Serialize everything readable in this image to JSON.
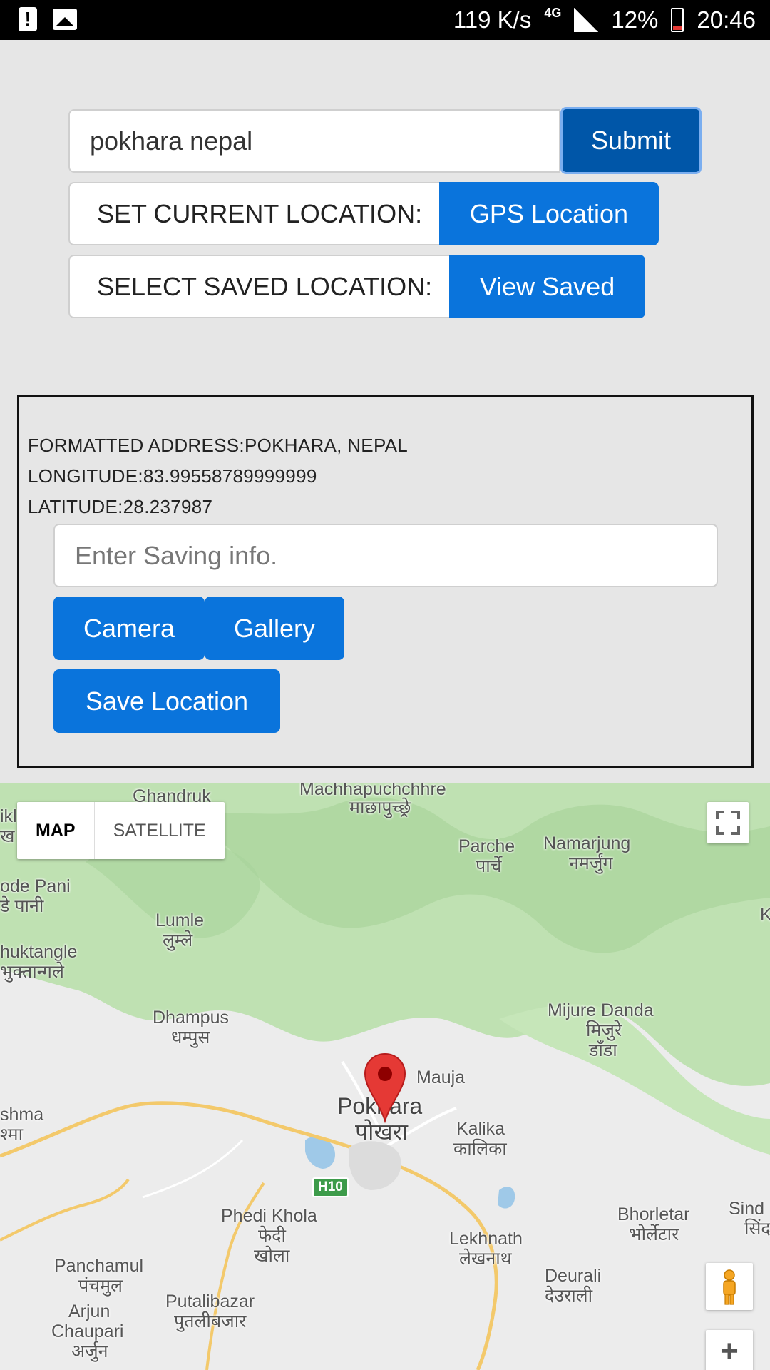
{
  "status_bar": {
    "net_speed": "119 K/s",
    "network_type": "4G",
    "battery": "12%",
    "time": "20:46",
    "icons": [
      "alert-icon",
      "image-icon",
      "signal-icon",
      "battery-icon"
    ]
  },
  "search": {
    "value": "pokhara nepal",
    "submit_label": "Submit"
  },
  "current_location": {
    "label": "SET CURRENT LOCATION:",
    "button": "GPS Location"
  },
  "saved_location": {
    "label": "SELECT SAVED LOCATION:",
    "button": "View Saved"
  },
  "info": {
    "formatted_address": "FORMATTED ADDRESS:POKHARA, NEPAL",
    "longitude": "LONGITUDE:83.99558789999999",
    "latitude": "LATITUDE:28.237987",
    "saving_placeholder": "Enter Saving info.",
    "camera_label": "Camera",
    "gallery_label": "Gallery",
    "save_label": "Save Location"
  },
  "map": {
    "type_map": "MAP",
    "type_satellite": "SATELLITE",
    "zoom_in": "+",
    "route_badge": "H10",
    "places": {
      "ghandruk": "Ghandruk",
      "machhapuchchhre": "Machhapuchchhre",
      "machhapuchchhre_np": "माछापुच्छ्रे",
      "parche": "Parche",
      "parche_np": "पार्चे",
      "namarjung": "Namarjung",
      "namarjung_np": "नमर्जुंग",
      "dode_pani": "ode Pani",
      "dode_pani_np": "डे पानी",
      "lumle": "Lumle",
      "lumle_np": "लुम्ले",
      "bhuktangle": "huktangle",
      "bhuktangle_np": "भुक्तान्गले",
      "ikh": "ikl",
      "ikh_np": "ख",
      "k_edge": "K",
      "dhampus": "Dhampus",
      "dhampus_np": "धम्पुस",
      "mijure_danda": "Mijure Danda",
      "mijure_danda_np1": "मिजुरे",
      "mijure_danda_np2": "डाँडा",
      "mauja": "Mauja",
      "pokhara": "Pokhara",
      "pokhara_np": "पोखरा",
      "kalika": "Kalika",
      "kalika_np": "कालिका",
      "shma": "shma",
      "shma_np": "श्मा",
      "phedi_khola": "Phedi Khola",
      "phedi_khola_np1": "फेदी",
      "phedi_khola_np2": "खोला",
      "lekhnath": "Lekhnath",
      "lekhnath_np": "लेखनाथ",
      "bhorletar": "Bhorletar",
      "bhorletar_np": "भोर्लेटार",
      "sindh": "Sind",
      "sindh_np": "सिंद",
      "panchamul": "Panchamul",
      "panchamul_np": "पंचमुल",
      "arjun_chaupari": "Arjun",
      "arjun_chaupari2": "Chaupari",
      "arjun_chaupari_np": "अर्जुन",
      "putalibazar": "Putalibazar",
      "putalibazar_np": "पुतलीबजार",
      "deurali": "Deurali",
      "deurali_np": "देउराली"
    }
  },
  "colors": {
    "primary_button": "#0a74dc",
    "submit_button": "#0056a8",
    "page_background": "#e6e6e6",
    "map_pin": "#e53935"
  }
}
